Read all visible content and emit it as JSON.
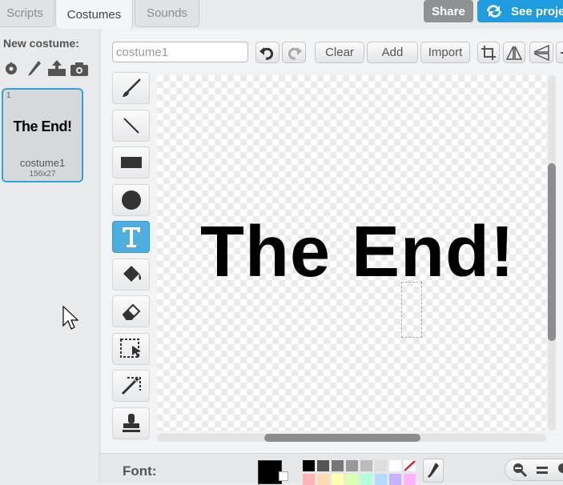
{
  "tabs": [
    {
      "label": "Scripts"
    },
    {
      "label": "Costumes"
    },
    {
      "label": "Sounds"
    }
  ],
  "header": {
    "share_label": "Share",
    "see_project_label": "See proje"
  },
  "sidebar": {
    "new_costume_label": "New costume:",
    "new_icons": [
      "choose-costume-icon",
      "paint-icon",
      "upload-icon",
      "camera-icon"
    ],
    "costume": {
      "number": "1",
      "preview_text": "The End!",
      "name": "costume1",
      "size": "156x27"
    }
  },
  "editor": {
    "name_value": "costume1",
    "clear_label": "Clear",
    "add_label": "Add",
    "import_label": "Import",
    "canvas_text": "The End!",
    "font_label": "Font:",
    "active_tool": "text-tool",
    "tools": [
      "brush-tool",
      "line-tool",
      "rectangle-tool",
      "ellipse-tool",
      "text-tool",
      "fill-tool",
      "eraser-tool",
      "select-tool",
      "remove-background-tool",
      "stamp-tool"
    ]
  },
  "palette_colors": [
    "#000000",
    "#555555",
    "#777777",
    "#999999",
    "#bbbbbb",
    "#dddddd",
    "#ffffff",
    "none",
    "#ffb3b3",
    "#ffd9b3",
    "#ffffb3",
    "#d9ffb3",
    "#b3ffd9",
    "#b3d9ff",
    "#c6b3ff",
    "#ffb3ff"
  ],
  "colors": {
    "accent": "#1f9be0",
    "selected_tool": "#4faee0",
    "thumb_border": "#2fa3de"
  }
}
